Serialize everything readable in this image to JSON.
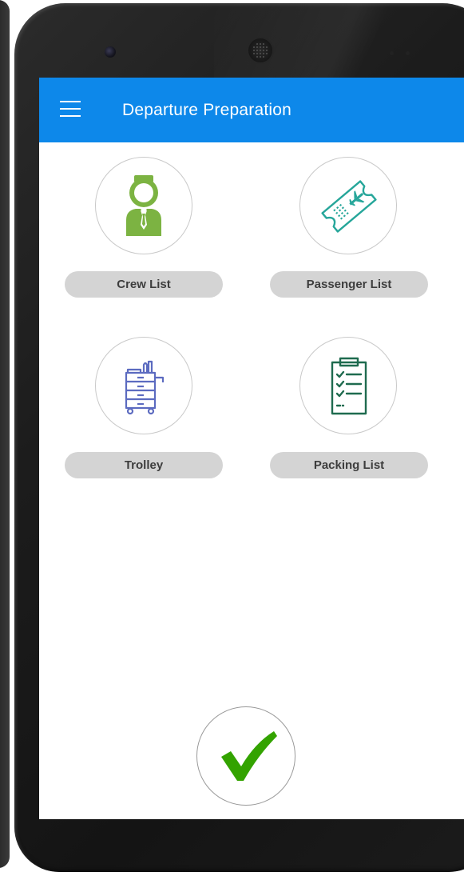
{
  "app_bar": {
    "title": "Departure Preparation",
    "menu_icon": "hamburger-menu-icon",
    "color": "#0d88ea"
  },
  "tiles": [
    {
      "label": "Crew List",
      "icon": "crew-member-icon",
      "icon_color": "#7cb342"
    },
    {
      "label": "Passenger List",
      "icon": "boarding-pass-icon",
      "icon_color": "#26a69a"
    },
    {
      "label": "Trolley",
      "icon": "trolley-icon",
      "icon_color": "#5c6bc0"
    },
    {
      "label": "Packing List",
      "icon": "clipboard-checklist-icon",
      "icon_color": "#1f6b4f"
    }
  ],
  "confirm": {
    "icon": "checkmark-icon",
    "color": "#33a300"
  }
}
